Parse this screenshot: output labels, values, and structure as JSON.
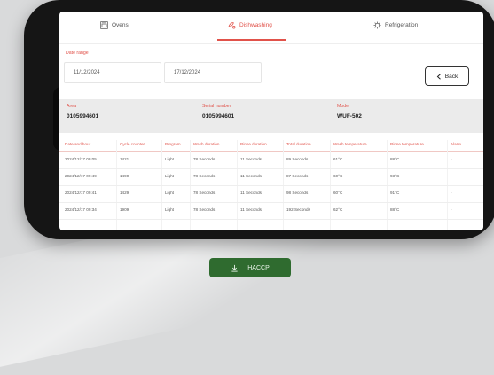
{
  "tabs": [
    {
      "label": "Ovens",
      "icon": "oven-icon"
    },
    {
      "label": "Dishwashing",
      "icon": "dishwashing-icon",
      "active": true
    },
    {
      "label": "Refrigeration",
      "icon": "gear-icon"
    }
  ],
  "date_range": {
    "label": "Date range",
    "from": "11/12/2024",
    "to": "17/12/2024"
  },
  "back_label": "Back",
  "info": {
    "area_label": "Area",
    "area_value": "0105994601",
    "serial_label": "Serial number",
    "serial_value": "0105994601",
    "model_label": "Model",
    "model_value": "WUF-502"
  },
  "table": {
    "headers": [
      "Date and hour",
      "Cycle counter",
      "Program",
      "Wash duration",
      "Rinse duration",
      "Total duration",
      "Wash temperature",
      "Rinse temperature",
      "Alarm"
    ],
    "rows": [
      [
        "2024/12/17 09:05",
        "1421",
        "Light",
        "78 Seconds",
        "11 Seconds",
        "89 Seconds",
        "61°C",
        "88°C",
        "-"
      ],
      [
        "2024/12/17 09:49",
        "1490",
        "Light",
        "78 Seconds",
        "11 Seconds",
        "87 Seconds",
        "60°C",
        "93°C",
        "-"
      ],
      [
        "2024/12/17 09:41",
        "1429",
        "Light",
        "78 Seconds",
        "11 Seconds",
        "98 Seconds",
        "60°C",
        "91°C",
        "-"
      ],
      [
        "2024/12/17 09:34",
        "1909",
        "Light",
        "78 Seconds",
        "11 Seconds",
        "192 Seconds",
        "62°C",
        "88°C",
        "-"
      ]
    ]
  },
  "haccp_label": "HACCP",
  "colors": {
    "accent": "#e1524a",
    "button": "#2f6b2f"
  }
}
